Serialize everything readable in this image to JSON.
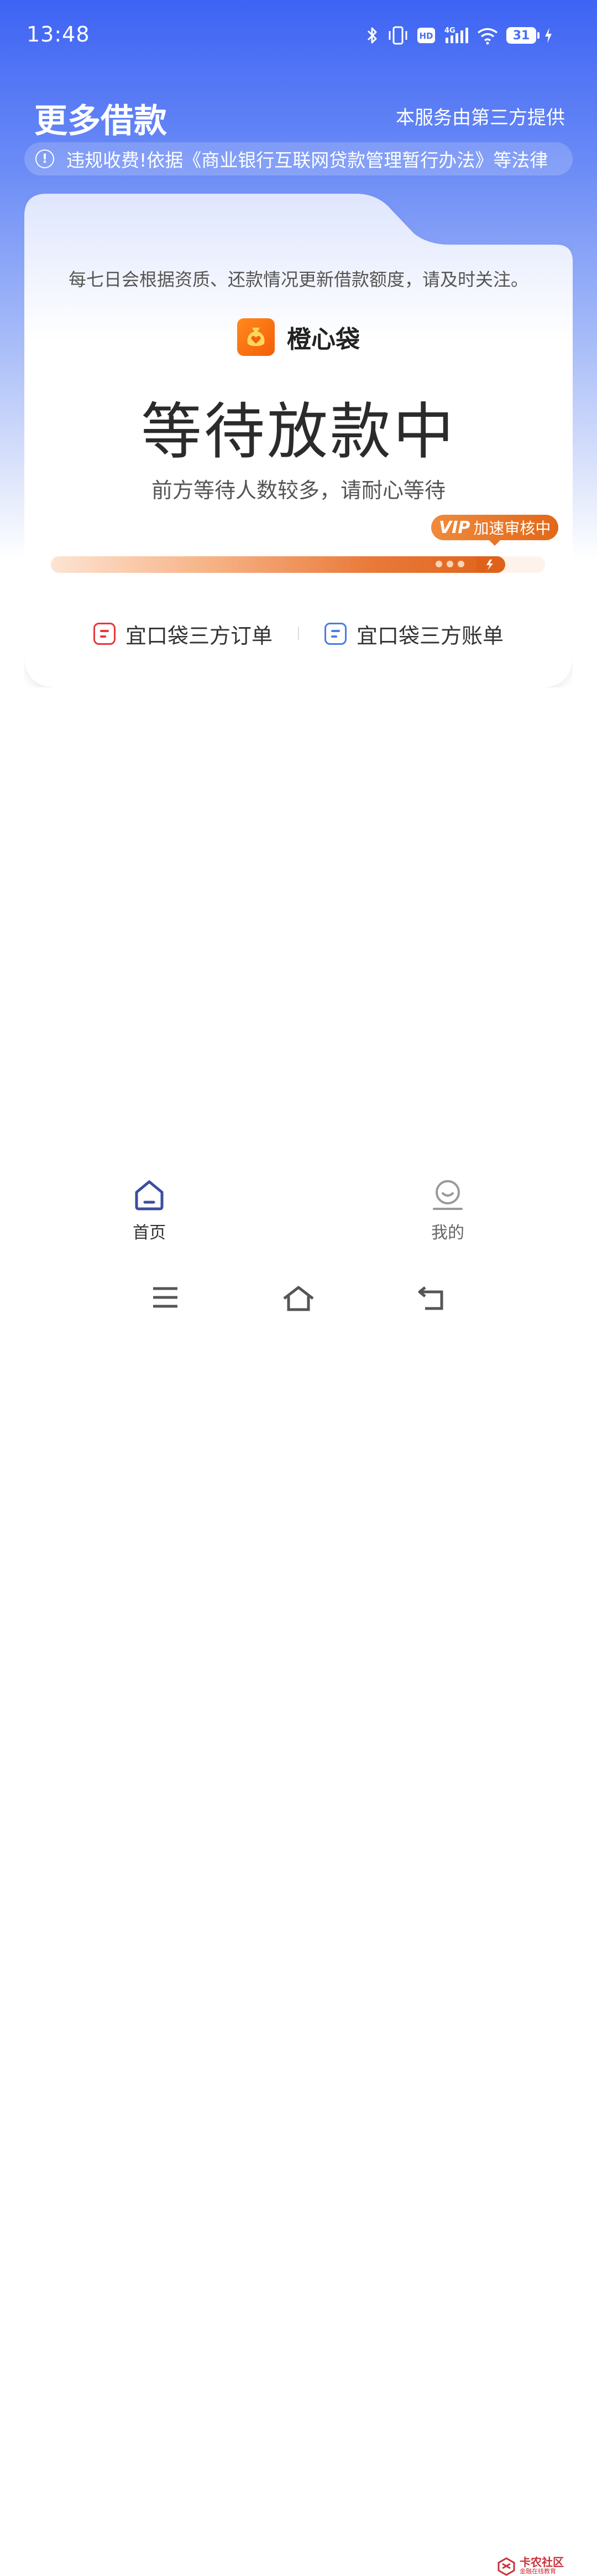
{
  "status_bar": {
    "time": "13:48",
    "network": "4G",
    "hd": "HD",
    "battery": "31"
  },
  "header": {
    "title": "更多借款",
    "provider_note": "本服务由第三方提供"
  },
  "notice": {
    "text": "违规收费!依据《商业银行互联网贷款管理暂行办法》等法律"
  },
  "card": {
    "credit_note": "每七日会根据资质、还款情况更新借款额度，请及时关注。",
    "brand_name": "橙心袋",
    "status_title": "等待放款中",
    "status_subtitle": "前方等待人数较多，请耐心等待",
    "vip_label": "VIP",
    "vip_text": "加速审核中",
    "progress": 0.92,
    "links": [
      {
        "label": "宜口袋三方订单",
        "color": "#e8353b"
      },
      {
        "label": "宜口袋三方账单",
        "color": "#4a7be8"
      }
    ]
  },
  "bottom_nav": [
    {
      "label": "首页",
      "icon": "home-icon",
      "active": true
    },
    {
      "label": "我的",
      "icon": "profile-icon",
      "active": false
    }
  ],
  "watermark": {
    "title": "卡农社区",
    "subtitle": "金融在线教育"
  },
  "colors": {
    "primary_blue": "#3d63f4",
    "accent_orange": "#e26818",
    "red": "#e8353b",
    "blue": "#4a7be8"
  }
}
